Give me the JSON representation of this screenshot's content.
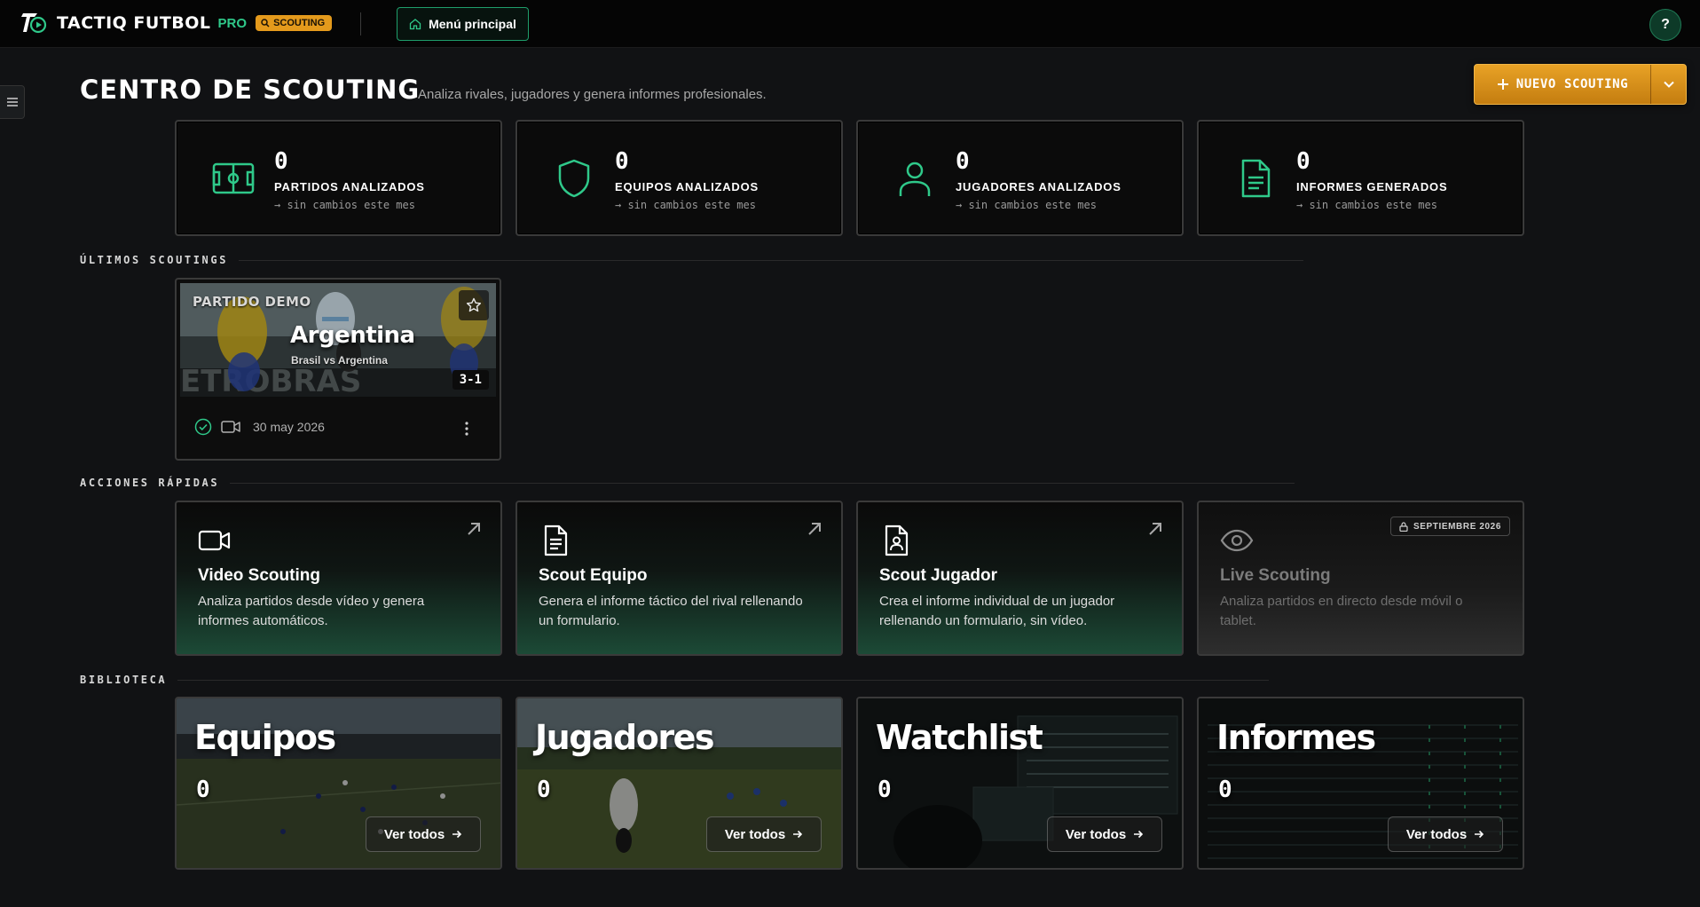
{
  "topbar": {
    "brand": "TACTIQ FUTBOL",
    "brand_pro": "PRO",
    "module_badge": "SCOUTING",
    "menu_button": "Menú principal",
    "help": "?"
  },
  "header": {
    "title": "CENTRO DE SCOUTING",
    "subtitle": "Analiza rivales, jugadores y genera informes profesionales.",
    "new_button": "NUEVO SCOUTING"
  },
  "stats": [
    {
      "value": "0",
      "label": "PARTIDOS ANALIZADOS",
      "delta": "→ sin cambios este mes",
      "icon": "field-icon"
    },
    {
      "value": "0",
      "label": "EQUIPOS ANALIZADOS",
      "delta": "→ sin cambios este mes",
      "icon": "shield-icon"
    },
    {
      "value": "0",
      "label": "JUGADORES ANALIZADOS",
      "delta": "→ sin cambios este mes",
      "icon": "user-icon"
    },
    {
      "value": "0",
      "label": "INFORMES GENERADOS",
      "delta": "→ sin cambios este mes",
      "icon": "document-icon"
    }
  ],
  "sections": {
    "recent": "ÚLTIMOS SCOUTINGS",
    "quick": "ACCIONES RÁPIDAS",
    "library": "BIBLIOTECA"
  },
  "recent_scouting": {
    "tag": "PARTIDO DEMO",
    "title": "Argentina",
    "match": "Brasil vs Argentina",
    "score": "3-1",
    "date": "30 may 2026"
  },
  "quick_actions": [
    {
      "title": "Video Scouting",
      "desc": "Analiza partidos desde vídeo y genera informes automáticos.",
      "icon": "video-icon"
    },
    {
      "title": "Scout Equipo",
      "desc": "Genera el informe táctico del rival rellenando un formulario.",
      "icon": "document-icon"
    },
    {
      "title": "Scout Jugador",
      "desc": "Crea el informe individual de un jugador rellenando un formulario, sin vídeo.",
      "icon": "player-file-icon"
    },
    {
      "title": "Live Scouting",
      "desc": "Analiza partidos en directo desde móvil o tablet.",
      "icon": "eye-icon",
      "badge": "SEPTIEMBRE 2026"
    }
  ],
  "library": [
    {
      "title": "Equipos",
      "count": "0",
      "button": "Ver todos"
    },
    {
      "title": "Jugadores",
      "count": "0",
      "button": "Ver todos"
    },
    {
      "title": "Watchlist",
      "count": "0",
      "button": "Ver todos"
    },
    {
      "title": "Informes",
      "count": "0",
      "button": "Ver todos"
    }
  ],
  "colors": {
    "accent_green": "#2fc98a",
    "accent_orange": "#e49a1c",
    "background": "#111214"
  }
}
